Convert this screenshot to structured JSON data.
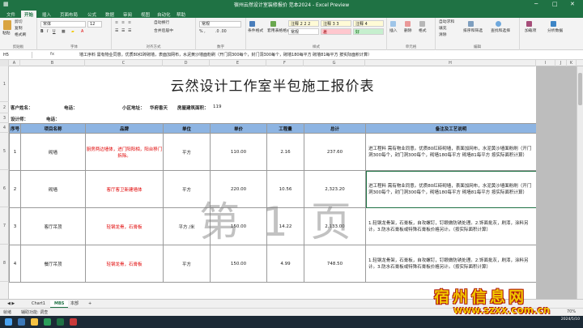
{
  "window": {
    "title": "宿州云然设计室装修报价 范本2024 - Excel Preview",
    "controls": [
      "─",
      "□",
      "✕"
    ]
  },
  "tabs": [
    "文件",
    "开始",
    "插入",
    "页面布局",
    "公式",
    "数据",
    "审阅",
    "视图",
    "自动化",
    "帮助"
  ],
  "ribbon": {
    "paste": "粘贴",
    "cut": "剪切",
    "copy": "复制",
    "format_painter": "格式刷",
    "clipboard": "剪贴板",
    "font_name": "宋体",
    "font_size": "12",
    "font": "字体",
    "wrap": "自动换行",
    "merge": "合并后居中",
    "alignment": "对齐方式",
    "number_format": "常规",
    "number": "数字",
    "cond_format": "条件格式",
    "table_format": "套用表格格式",
    "styles_group": "样式",
    "style_cells": [
      "注释 2 2 2",
      "注释 3 3",
      "注释 4",
      "常规",
      "差",
      "好"
    ],
    "insert": "插入",
    "delete": "删除",
    "format": "格式",
    "cells": "单元格",
    "autosum": "自动求和",
    "fill": "填充",
    "clear": "清除",
    "sort": "排序和筛选",
    "find": "查找和选择",
    "editing": "编辑",
    "addins": "加载项",
    "data_analysis": "分析数据"
  },
  "formula_bar": {
    "name_box": "H5",
    "fx": "fx",
    "content": "墙工序料 需有物业同意。优质80红砖砌墙，表面加网布，水泥黄沙墙面粉刷（开门洞300每个，封门洞300每个，砌墙180每平方 砌墙81每平方 按实际面积计算）"
  },
  "columns": [
    "A",
    "B",
    "C",
    "D",
    "E",
    "F",
    "G",
    "H",
    "I",
    "J",
    "K"
  ],
  "rows": [
    "1",
    "2",
    "3",
    "4",
    "5",
    "6",
    "7",
    "8"
  ],
  "sheet": {
    "title": "云然设计工作室半包施工报价表",
    "customer_label": "客户姓名：",
    "phone_label": "电话：",
    "address_label": "小区地址：",
    "address_value": "华府香天",
    "area_label": "房屋建筑面积：",
    "area_value": "119",
    "designer_label": "设计师：",
    "designer_phone_label": "电话：",
    "headers": [
      "序号",
      "项目名称",
      "品牌",
      "单位",
      "单价",
      "工程量",
      "总计",
      "备注及工艺说明"
    ],
    "rows": [
      {
        "no": "1",
        "name": "砌墙",
        "brand": "厨房两边墙体，进门阳阳相，阳台移门拆除。",
        "unit": "平方",
        "price": "110.00",
        "qty": "2.16",
        "total": "237.60",
        "desc": "进工程料 需有物业同意。优质80红砖砌墙，表面加网布，水泥黄沙墙面粉刷（开门洞300每个，封门洞300每个，砌墙180每平方 砌墙81每平方 按实际面积计算）"
      },
      {
        "no": "2",
        "name": "砌墙",
        "brand": "客厅客卫新建墙体",
        "unit": "平方",
        "price": "220.00",
        "qty": "10.56",
        "total": "2,323.20",
        "desc": "进工程料 需有物业同意。优质80红砖砌墙，表面加网布，水泥黄沙墙面粉刷（开门洞300每个，封门洞300每个，砌墙180每平方 砌墙81每平方 按实际面积计算）"
      },
      {
        "no": "3",
        "name": "客厅吊顶",
        "brand": "轻钢龙骨，石膏板",
        "unit": "平方 /米",
        "price": "150.00",
        "qty": "14.22",
        "total": "2,133.00",
        "desc": "1.轻钢龙骨架，石膏板，自攻螺钉，钉眼做防锈处理。2.饰面批灰，刷漆，涂料另计。3.防水石膏板或特殊石膏板价格另计。（按实际面积计算）"
      },
      {
        "no": "4",
        "name": "餐厅吊顶",
        "brand": "轻钢龙骨，石膏板",
        "unit": "平方",
        "price": "150.00",
        "qty": "4.99",
        "total": "748.50",
        "desc": "1.轻钢龙骨架，石膏板，自攻螺钉，钉眼做防锈处理。2.饰面批灰，刷漆，涂料另计。3.防水石膏板或特殊石膏板价格另计。（按实际面积计算）"
      }
    ],
    "watermark": "第 1 页"
  },
  "sheet_tabs": [
    "Chart1",
    "MBS",
    "本部",
    "+"
  ],
  "active_sheet_index": 1,
  "status": {
    "ready": "就绪",
    "accessibility": "辅助功能: 调查",
    "zoom": "70%"
  },
  "taskbar": {
    "time": "2024/5/10"
  },
  "site_logo": {
    "line1": "宿州信息网",
    "line2": "www.szxx.com.cn"
  },
  "colors": {
    "excel_green": "#1f7244",
    "header_blue": "#8db4e2",
    "brand_red": "#e00000"
  }
}
